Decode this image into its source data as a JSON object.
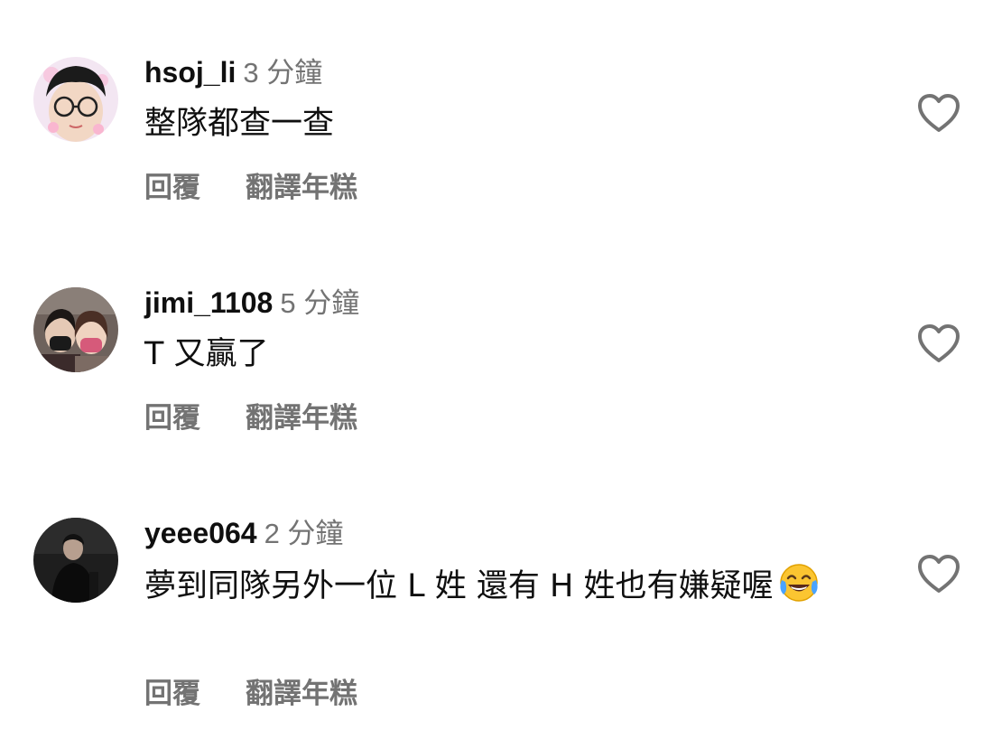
{
  "comments": [
    {
      "username": "hsoj_li",
      "time": "3 分鐘",
      "text": "整隊都查一查",
      "reply_label": "回覆",
      "translate_label": "翻譯年糕"
    },
    {
      "username": "jimi_1108",
      "time": "5 分鐘",
      "text": "T 又贏了",
      "reply_label": "回覆",
      "translate_label": "翻譯年糕"
    },
    {
      "username": "yeee064",
      "time": "2 分鐘",
      "text": "夢到同隊另外一位 L 姓  還有 H 姓也有嫌疑喔",
      "emoji": "face-with-tears-of-joy",
      "reply_label": "回覆",
      "translate_label": "翻譯年糕"
    }
  ],
  "icons": {
    "like": "heart-outline-icon"
  },
  "colors": {
    "text": "#0f0f0f",
    "secondary": "#737373",
    "background": "#ffffff"
  }
}
